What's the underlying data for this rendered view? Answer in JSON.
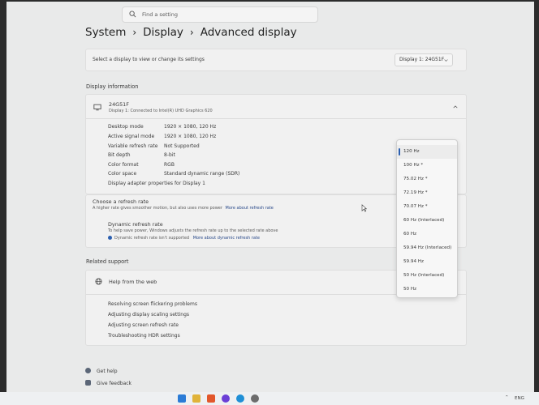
{
  "search": {
    "placeholder": "Find a setting"
  },
  "breadcrumb": {
    "root": "System",
    "parent": "Display",
    "current": "Advanced display",
    "separator": "›"
  },
  "display_select": {
    "prompt": "Select a display to view or change its settings",
    "value": "Display 1: 24G51F"
  },
  "display_info": {
    "section_title": "Display information",
    "monitor_name": "24G51F",
    "monitor_sub": "Display 1: Connected to Intel(R) UHD Graphics 620",
    "rows": [
      {
        "key": "Desktop mode",
        "value": "1920 × 1080, 120 Hz"
      },
      {
        "key": "Active signal mode",
        "value": "1920 × 1080, 120 Hz"
      },
      {
        "key": "Variable refresh rate",
        "value": "Not Supported"
      },
      {
        "key": "Bit depth",
        "value": "8-bit"
      },
      {
        "key": "Color format",
        "value": "RGB"
      },
      {
        "key": "Color space",
        "value": "Standard dynamic range (SDR)"
      }
    ],
    "adapter_link": "Display adapter properties for Display 1"
  },
  "refresh": {
    "title": "Choose a refresh rate",
    "desc": "A higher rate gives smoother motion, but also uses more power",
    "link": "More about refresh rate"
  },
  "dynamic_refresh": {
    "title": "Dynamic refresh rate",
    "desc": "To help save power, Windows adjusts the refresh rate up to the selected rate above",
    "note": "Dynamic refresh rate isn't supported",
    "note_link": "More about dynamic refresh rate"
  },
  "refresh_options": [
    "120 Hz",
    "100 Hz *",
    "75.02 Hz *",
    "72.19 Hz *",
    "70.07 Hz *",
    "60 Hz (Interlaced)",
    "60 Hz",
    "59.94 Hz (Interlaced)",
    "59.94 Hz",
    "50 Hz (Interlaced)",
    "50 Hz"
  ],
  "selected_option": "120 Hz",
  "related": {
    "title": "Related support",
    "help_title": "Help from the web",
    "links": [
      "Resolving screen flickering problems",
      "Adjusting display scaling settings",
      "Adjusting screen refresh rate",
      "Troubleshooting HDR settings"
    ]
  },
  "footer": {
    "get_help": "Get help",
    "feedback": "Give feedback"
  },
  "taskbar": {
    "lang": "ENG"
  },
  "colors": {
    "accent": "#2b5fb0",
    "background": "#e9eaea",
    "card": "#f1f1f1"
  }
}
